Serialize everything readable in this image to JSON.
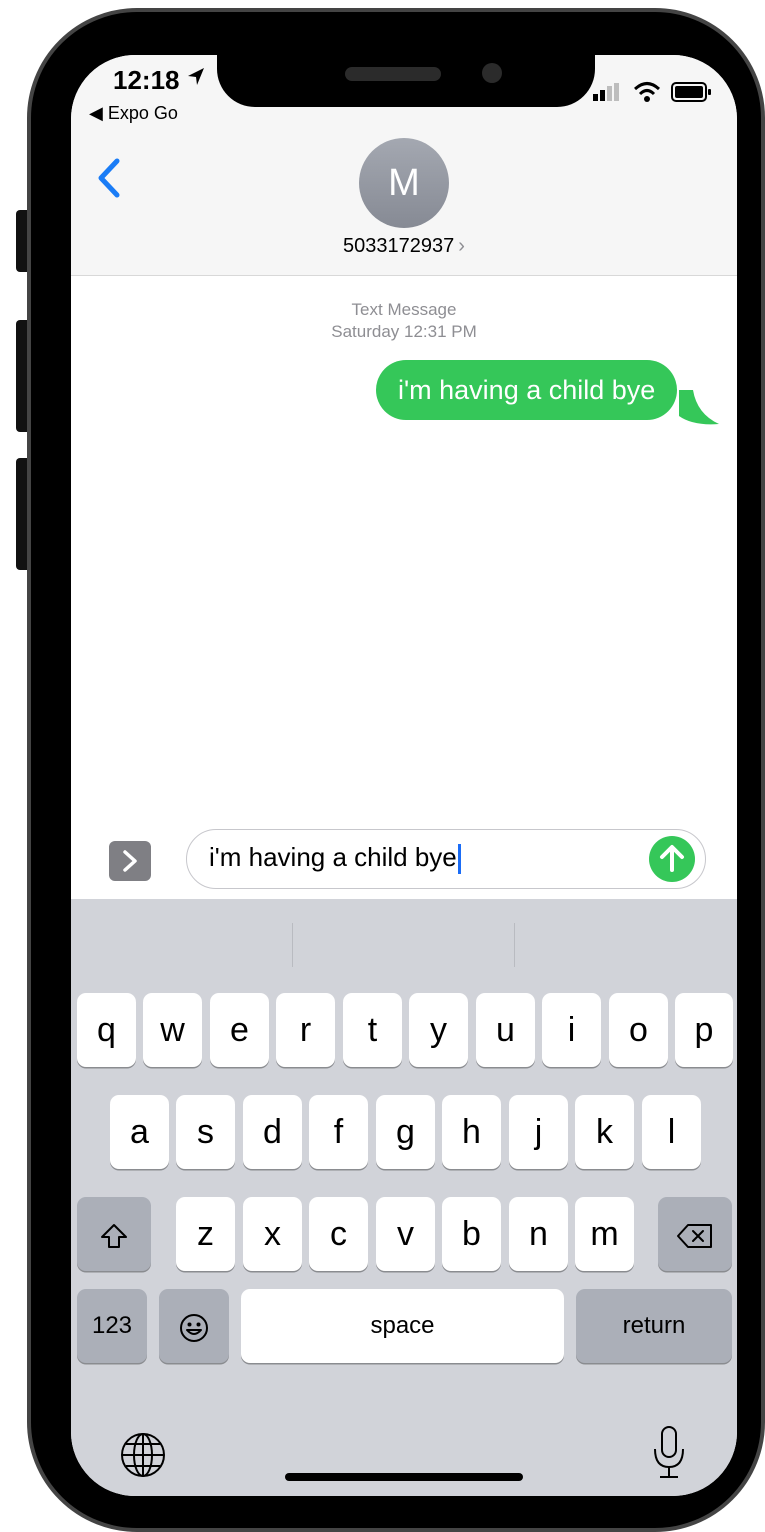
{
  "status_bar": {
    "time": "12:18",
    "back_app": "◀ Expo Go"
  },
  "header": {
    "avatar_initial": "M",
    "contact": "5033172937",
    "contact_chevron": "›"
  },
  "conversation": {
    "service": "Text Message",
    "timestamp": "Saturday 12:31 PM",
    "messages": [
      {
        "text": "i'm having a child bye",
        "sender": "me"
      }
    ]
  },
  "input": {
    "value": "i'm having a child bye"
  },
  "keyboard": {
    "row1": [
      "q",
      "w",
      "e",
      "r",
      "t",
      "y",
      "u",
      "i",
      "o",
      "p"
    ],
    "row2": [
      "a",
      "s",
      "d",
      "f",
      "g",
      "h",
      "j",
      "k",
      "l"
    ],
    "row3": [
      "z",
      "x",
      "c",
      "v",
      "b",
      "n",
      "m"
    ],
    "numbers_label": "123",
    "space_label": "space",
    "return_label": "return"
  },
  "colors": {
    "imessage_green": "#35c759",
    "ios_blue": "#1a7cf6",
    "keyboard_bg": "#d1d3d9"
  }
}
